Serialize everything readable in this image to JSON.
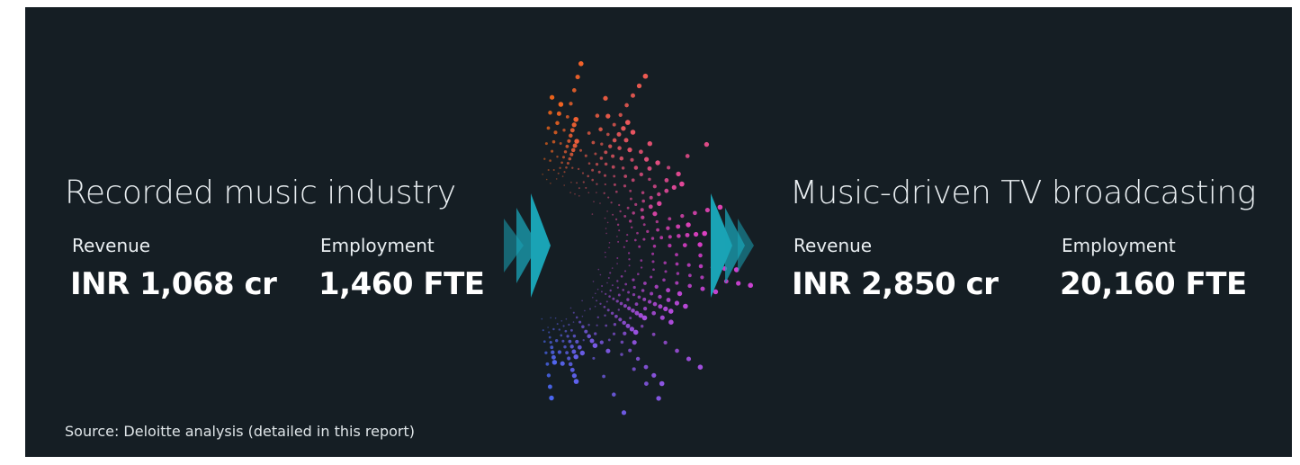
{
  "left": {
    "title": "Recorded music industry",
    "revenue_label": "Revenue",
    "revenue_value": "INR 1,068 cr",
    "employment_label": "Employment",
    "employment_value": "1,460 FTE"
  },
  "right": {
    "title": "Music-driven TV broadcasting",
    "revenue_label": "Revenue",
    "revenue_value": "INR 2,850 cr",
    "employment_label": "Employment",
    "employment_value": "20,160 FTE"
  },
  "source": "Source: Deloitte analysis (detailed in this report)",
  "colors": {
    "background": "#151e24",
    "arrow_teal": "#1aa3b5",
    "burst_top": "#ff6a1a",
    "burst_mid": "#e53fd6",
    "burst_bottom": "#4f6cff"
  }
}
